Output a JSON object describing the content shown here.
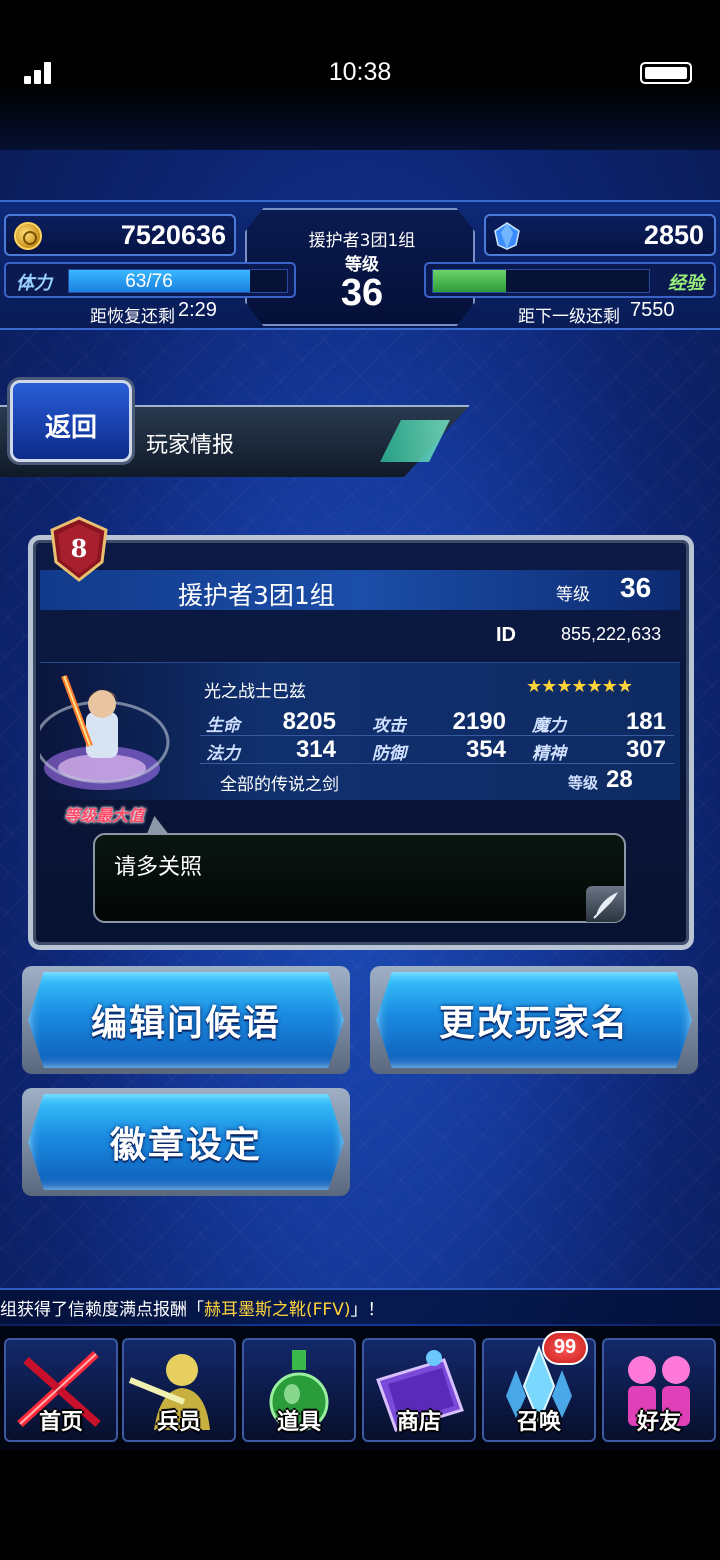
{
  "status_bar": {
    "time": "10:38"
  },
  "header": {
    "gil": "7520636",
    "lapis": "2850",
    "player_name": "援护者3团1组",
    "level_label": "等级",
    "level": "36",
    "stamina_label": "体力",
    "stamina": "63/76",
    "stamina_fraction": 0.83,
    "recover_label": "距恢复还剩",
    "recover_time": "2:29",
    "exp_label": "经验",
    "exp_fraction": 0.34,
    "next_label": "距下一级还剩",
    "next_value": "7550"
  },
  "nav_top": {
    "back_label": "返回",
    "page_title": "玩家情报"
  },
  "card": {
    "rank": "8",
    "name": "援护者3团1组",
    "level_label": "等级",
    "level": "36",
    "id_label": "ID",
    "id_value": "855,222,633",
    "unit_name": "光之战士巴兹",
    "stars": "★★★★★★★",
    "max_level_label": "等级最大值",
    "stats": [
      {
        "label": "生命",
        "value": "8205"
      },
      {
        "label": "攻击",
        "value": "2190"
      },
      {
        "label": "魔力",
        "value": "181"
      },
      {
        "label": "法力",
        "value": "314"
      },
      {
        "label": "防御",
        "value": "354"
      },
      {
        "label": "精神",
        "value": "307"
      }
    ],
    "equip_name": "全部的传说之剑",
    "equip_level_label": "等级",
    "equip_level": "28",
    "message": "请多关照"
  },
  "buttons": {
    "edit_greeting": "编辑问候语",
    "change_name": "更改玩家名",
    "badge_settings": "徽章设定"
  },
  "ticker": {
    "prefix": "组获得了信赖度满点报酬「",
    "highlight": "赫耳墨斯之靴(FFV)",
    "suffix": "」！"
  },
  "bottom_nav": [
    {
      "label": "首页",
      "icon": "home-swords-icon"
    },
    {
      "label": "兵员",
      "icon": "units-icon"
    },
    {
      "label": "道具",
      "icon": "items-potion-icon"
    },
    {
      "label": "商店",
      "icon": "shop-icon"
    },
    {
      "label": "召唤",
      "icon": "summon-crystal-icon"
    },
    {
      "label": "好友",
      "icon": "friends-icon"
    }
  ],
  "summon_badge": "99",
  "colors": {
    "accent": "#1a8ae0",
    "highlight": "#ffd23a",
    "background": "#15389a"
  }
}
